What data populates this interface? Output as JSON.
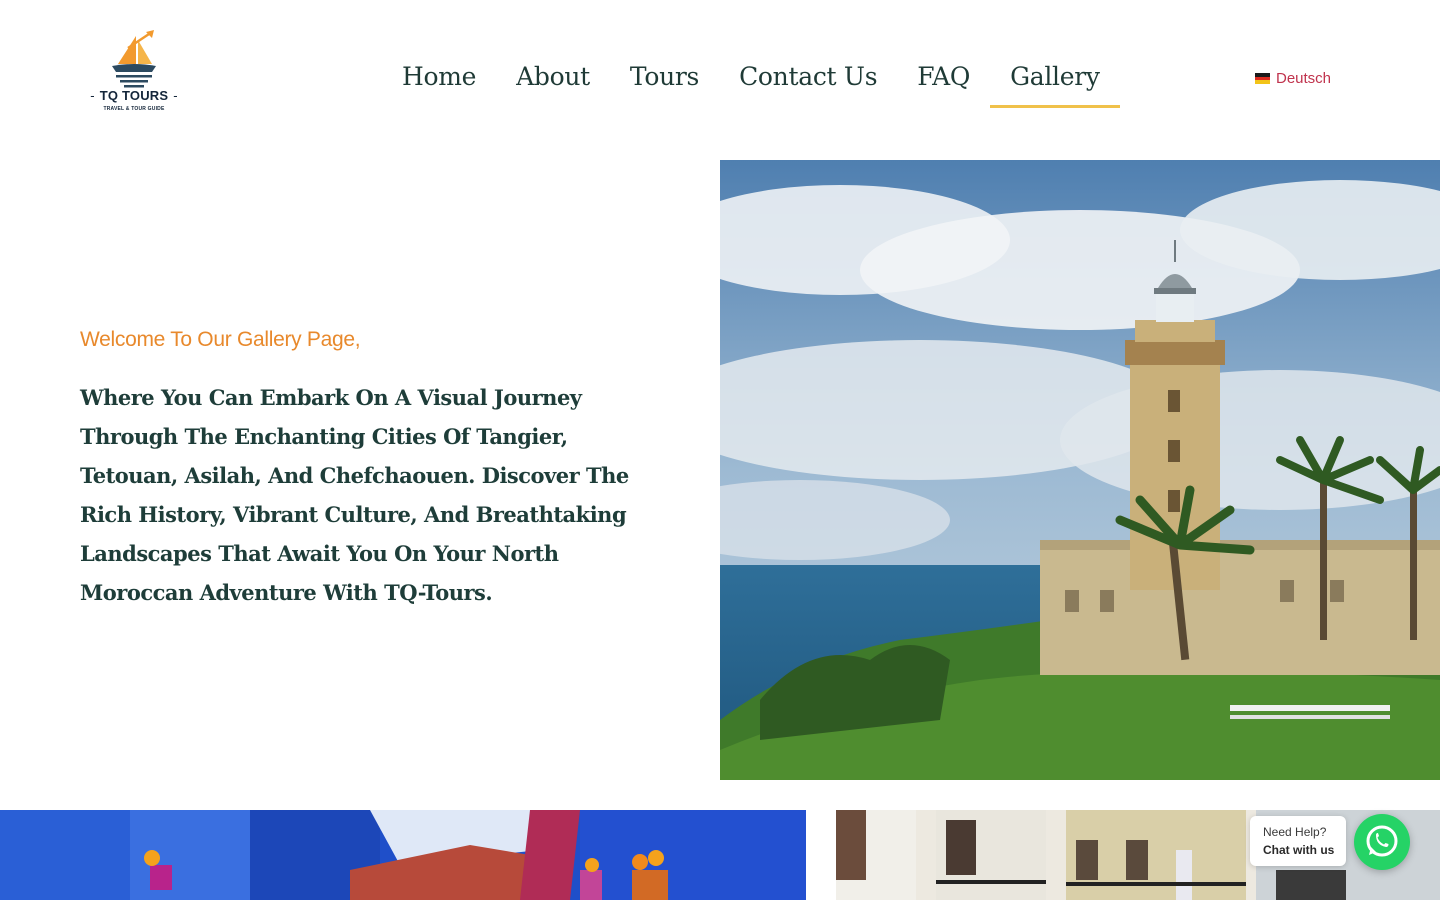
{
  "brand": {
    "name": "TQ TOURS",
    "tagline": "TRAVEL & TOUR GUIDE"
  },
  "nav": {
    "items": [
      {
        "label": "Home"
      },
      {
        "label": "About"
      },
      {
        "label": "Tours"
      },
      {
        "label": "Contact Us"
      },
      {
        "label": "FAQ"
      },
      {
        "label": "Gallery",
        "active": true
      }
    ]
  },
  "language": {
    "label": "Deutsch",
    "flag_icon": "german-flag-icon"
  },
  "intro": {
    "subtitle": "Welcome To Our Gallery Page,",
    "body": "Where You Can Embark On A Visual Journey Through The Enchanting Cities Of Tangier, Tetouan, Asilah, And Chefchaouen. Discover The Rich History, Vibrant Culture, And Breathtaking Landscapes That Await You On Your North Moroccan Adventure With TQ-Tours."
  },
  "chat": {
    "line1": "Need Help?",
    "line2": "Chat with us",
    "icon": "whatsapp-icon"
  },
  "colors": {
    "accent_orange": "#e8892c",
    "nav_underline": "#f0c14a",
    "heading_text": "#1e3d39",
    "lang_link": "#c0334d",
    "whatsapp_green": "#25d366"
  }
}
